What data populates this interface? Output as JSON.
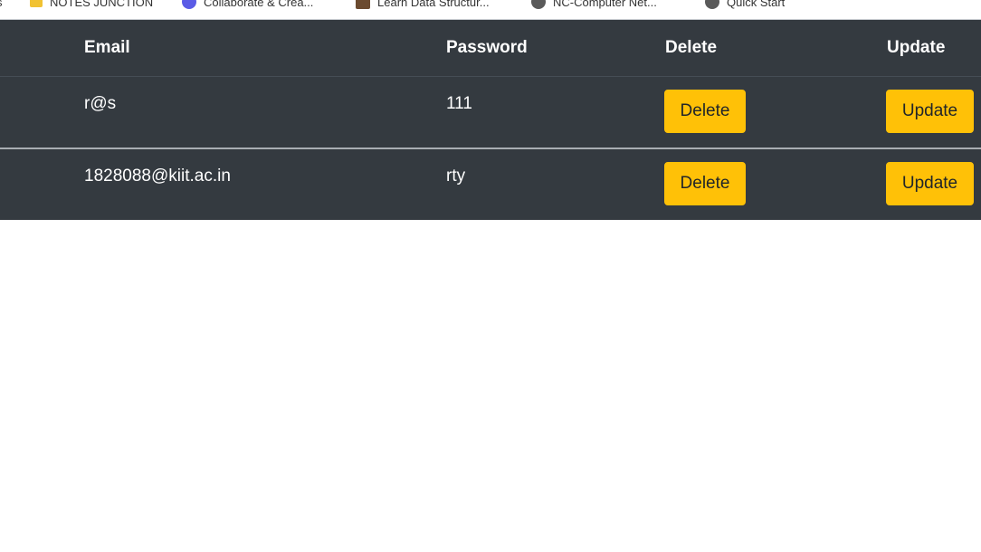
{
  "bookmarks": [
    {
      "icon": "partial-icon",
      "label": "s"
    },
    {
      "icon": "folder-icon",
      "label": "NOTES JUNCTION"
    },
    {
      "icon": "collab-icon",
      "label": "Collaborate & Crea..."
    },
    {
      "icon": "book-icon",
      "label": "Learn Data Structur..."
    },
    {
      "icon": "globe-icon",
      "label": "NC-Computer Net..."
    },
    {
      "icon": "globe-icon",
      "label": "Quick Start"
    }
  ],
  "table": {
    "headers": {
      "email": "Email",
      "password": "Password",
      "delete": "Delete",
      "update": "Update"
    },
    "rows": [
      {
        "email": "r@s",
        "password": "111",
        "delete_label": "Delete",
        "update_label": "Update"
      },
      {
        "email": "1828088@kiit.ac.in",
        "password": "rty",
        "delete_label": "Delete",
        "update_label": "Update"
      }
    ]
  },
  "colors": {
    "table_bg": "#343a40",
    "button_warning": "#ffc107",
    "text_light": "#ffffff",
    "text_dark": "#212529"
  }
}
